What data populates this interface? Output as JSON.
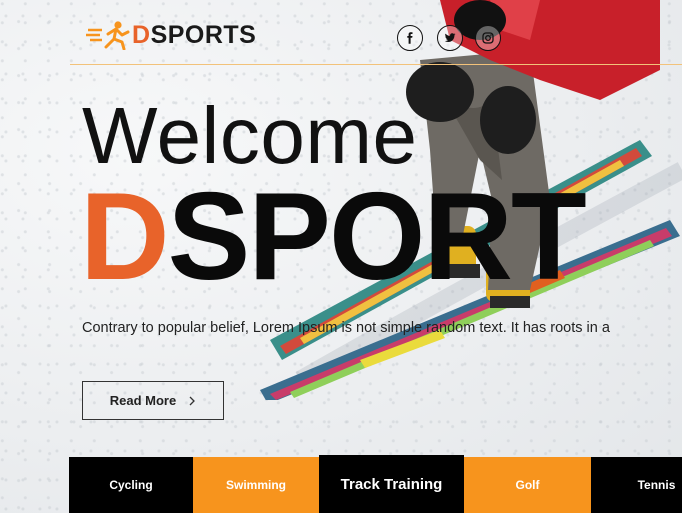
{
  "brand": {
    "logo_accent": "D",
    "logo_rest": "SPORTS",
    "accent_color": "#e8632a",
    "tab_color": "#f7941d"
  },
  "social": [
    {
      "name": "facebook-icon",
      "label": "f"
    },
    {
      "name": "twitter-icon",
      "label": "twitter"
    },
    {
      "name": "instagram-icon",
      "label": "instagram"
    }
  ],
  "hero": {
    "welcome": "Welcome",
    "brand_accent": "D",
    "brand_rest": "SPORT",
    "description": "Contrary to popular belief, Lorem Ipsum is not simple random text. It has roots in a",
    "read_more": "Read More",
    "read_more_icon": "chevron-right-icon"
  },
  "tabs": [
    {
      "label": "Cycling",
      "style": "black"
    },
    {
      "label": "Swimming",
      "style": "orange"
    },
    {
      "label": "Track Training",
      "style": "black"
    },
    {
      "label": "Golf",
      "style": "orange"
    },
    {
      "label": "Tennis",
      "style": "black"
    }
  ]
}
